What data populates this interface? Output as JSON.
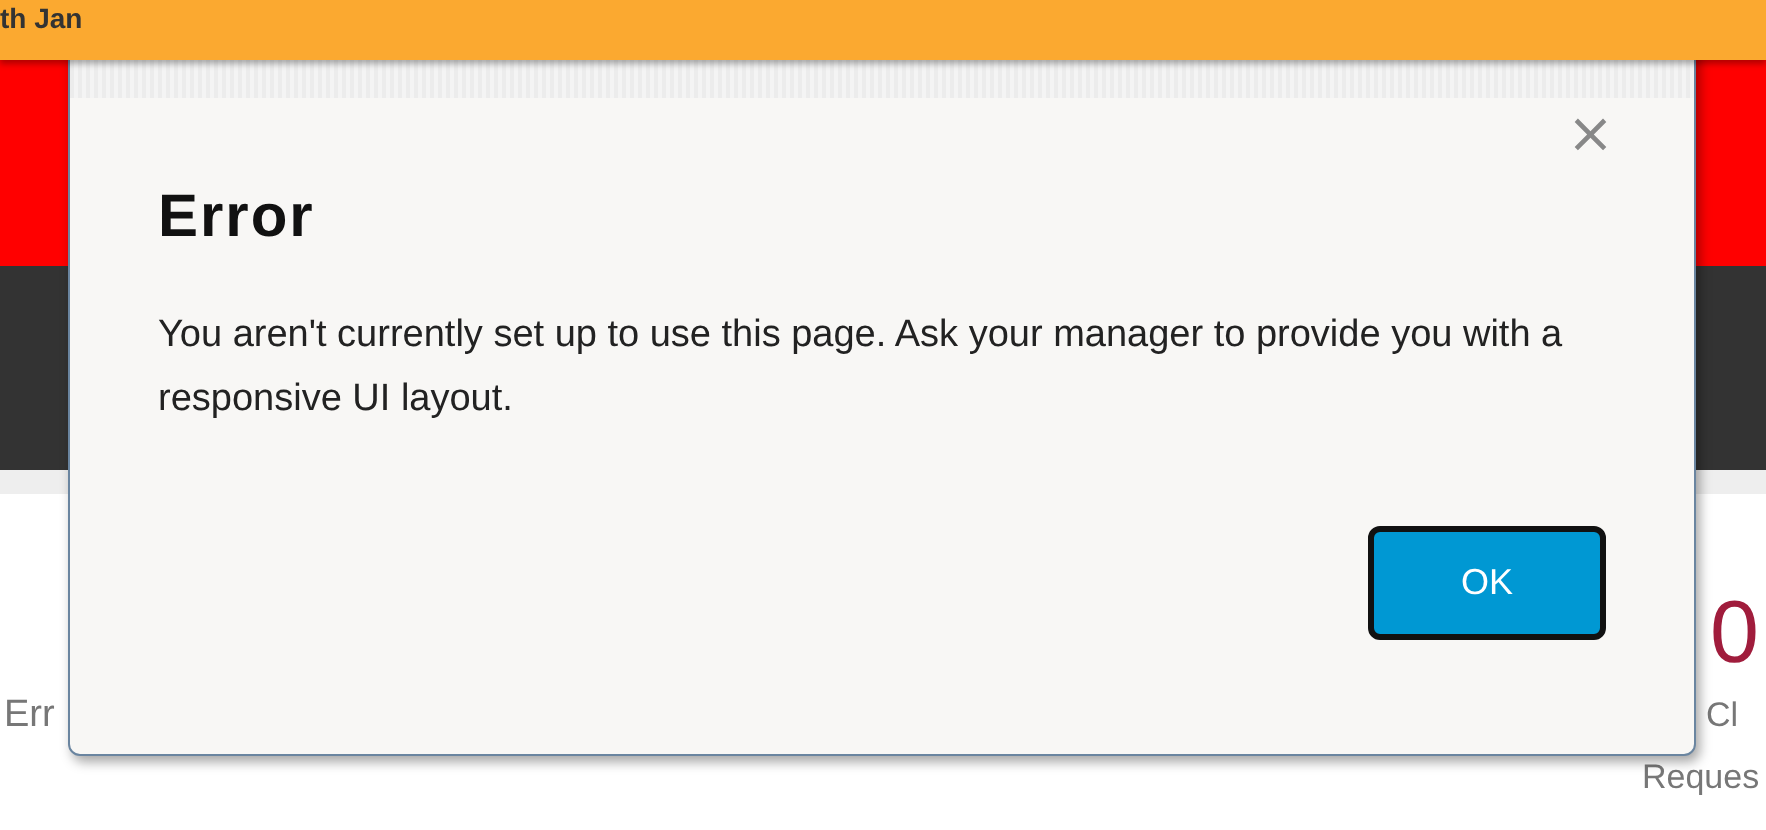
{
  "header": {
    "date_fragment": "th Jan"
  },
  "background_tiles": {
    "left_label": "Err",
    "right_count": "0",
    "right_label_lines": [
      "Cl",
      "Reques"
    ]
  },
  "dialog": {
    "title": "Error",
    "message": "You aren't currently set up to use this page. Ask your manager to provide you with a responsive UI layout.",
    "close_glyph": "×",
    "buttons": [
      "OK"
    ]
  }
}
